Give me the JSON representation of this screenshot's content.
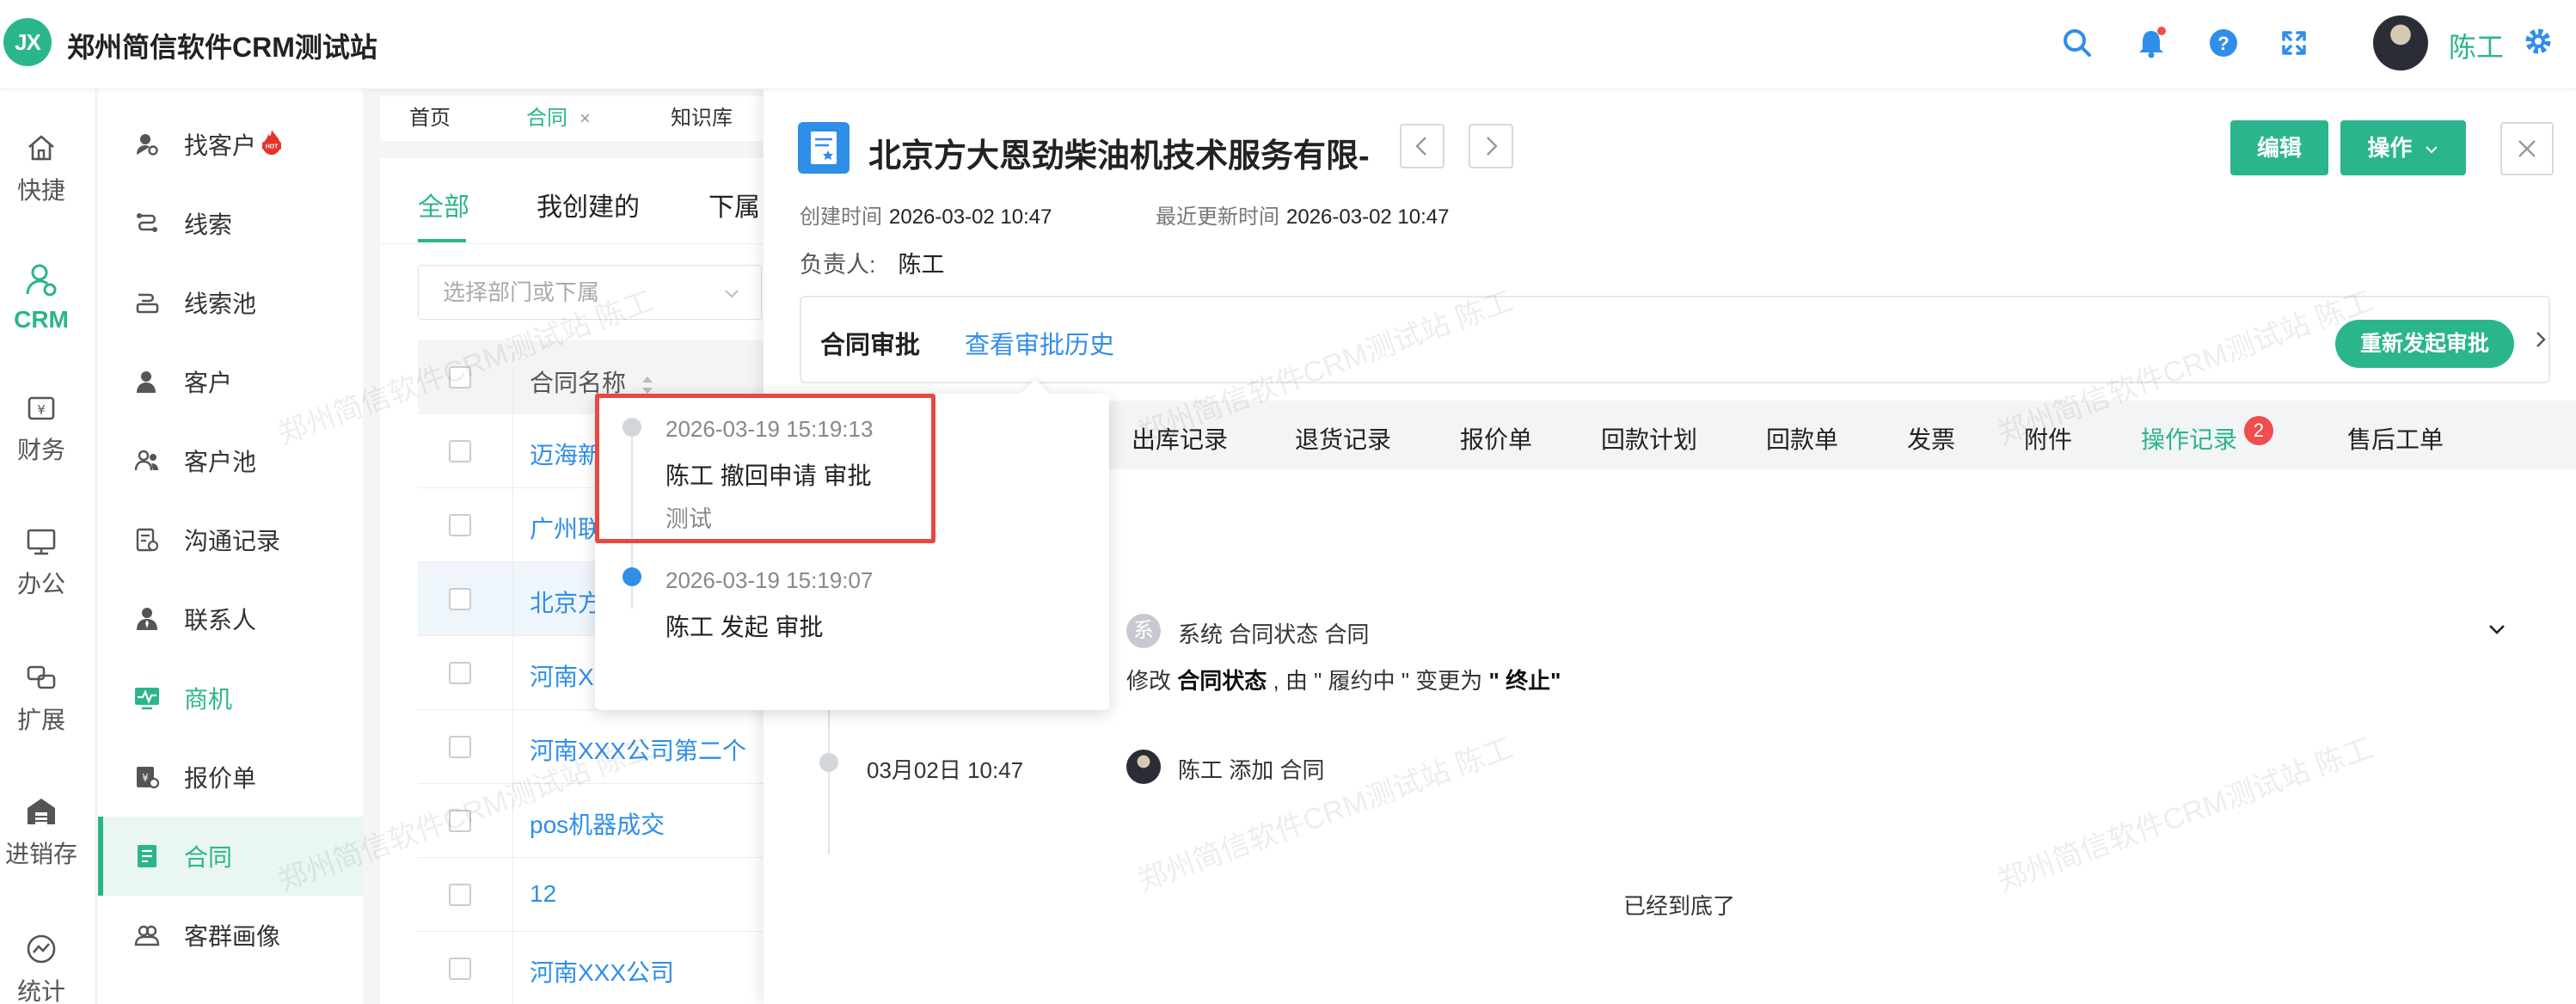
{
  "header": {
    "logo_text": "JX",
    "app_title": "郑州简信软件CRM测试站",
    "user_name": "陈工",
    "icons": [
      "search-icon",
      "bell-icon",
      "help-icon",
      "fullscreen-icon",
      "gear-icon"
    ],
    "accent_color": "#2bb58c",
    "link_color": "#2f8ee8"
  },
  "rail": {
    "items": [
      {
        "label": "快捷",
        "icon": "home-icon"
      },
      {
        "label": "CRM",
        "icon": "crm-user-icon",
        "active": true
      },
      {
        "label": "财务",
        "icon": "finance-icon"
      },
      {
        "label": "办公",
        "icon": "monitor-icon"
      },
      {
        "label": "扩展",
        "icon": "extension-icon"
      },
      {
        "label": "进销存",
        "icon": "warehouse-icon"
      },
      {
        "label": "统计",
        "icon": "stats-icon"
      }
    ]
  },
  "submenu": {
    "items": [
      {
        "label": "找客户",
        "icon": "find-customer-icon",
        "hot": true
      },
      {
        "label": "线索",
        "icon": "clue-icon"
      },
      {
        "label": "线索池",
        "icon": "clue-pool-icon"
      },
      {
        "label": "客户",
        "icon": "customer-icon"
      },
      {
        "label": "客户池",
        "icon": "customer-pool-icon"
      },
      {
        "label": "沟通记录",
        "icon": "communication-icon"
      },
      {
        "label": "联系人",
        "icon": "contact-icon"
      },
      {
        "label": "商机",
        "icon": "opportunity-icon"
      },
      {
        "label": "报价单",
        "icon": "quote-icon"
      },
      {
        "label": "合同",
        "icon": "contract-icon",
        "active": true
      },
      {
        "label": "客群画像",
        "icon": "persona-icon"
      }
    ]
  },
  "tabs": [
    {
      "label": "首页"
    },
    {
      "label": "合同",
      "active": true,
      "closable": true,
      "close_glyph": "×"
    },
    {
      "label": "知识库"
    }
  ],
  "list": {
    "filter_tabs": [
      "全部",
      "我创建的",
      "下属"
    ],
    "dept_placeholder": "选择部门或下属",
    "column_header": "合同名称",
    "rows": [
      "迈海新",
      "广州联",
      "北京方",
      "河南X",
      "河南XXX公司第二个",
      "pos机器成交",
      "12",
      "河南XXX公司"
    ]
  },
  "detail": {
    "title": "北京方大恩劲柴油机技术服务有限-",
    "created_label": "创建时间",
    "created_value": "2026-03-02 10:47",
    "updated_label": "最近更新时间",
    "updated_value": "2026-03-02 10:47",
    "owner_label": "负责人:",
    "owner_value": "陈工",
    "edit_label": "编辑",
    "operation_label": "操作",
    "approval_title": "合同审批",
    "approval_history_link": "查看审批历史",
    "resubmit_label": "重新发起审批",
    "subtabs": [
      "出库记录",
      "退货记录",
      "报价单",
      "回款计划",
      "回款单",
      "发票",
      "附件",
      "操作记录",
      "售后工单"
    ],
    "active_subtab": "操作记录",
    "subtab_badge": "2",
    "timeline": [
      {
        "avatar_text": "系",
        "header": "系统 合同状态 合同",
        "detail_prefix": "修改",
        "detail_field": "合同状态",
        "detail_middle": ", 由 \" 履约中 \" 变更为",
        "detail_new": "\" 终止\""
      },
      {
        "time": "03月02日 10:47",
        "header": "陈工 添加 合同"
      }
    ],
    "bottom_note": "已经到底了"
  },
  "popover": {
    "entries": [
      {
        "time": "2026-03-19 15:19:13",
        "action": "陈工 撤回申请 审批",
        "note": "测试"
      },
      {
        "time": "2026-03-19 15:19:07",
        "action": "陈工 发起 审批"
      }
    ]
  },
  "watermark": "郑州简信软件CRM测试站 陈工"
}
